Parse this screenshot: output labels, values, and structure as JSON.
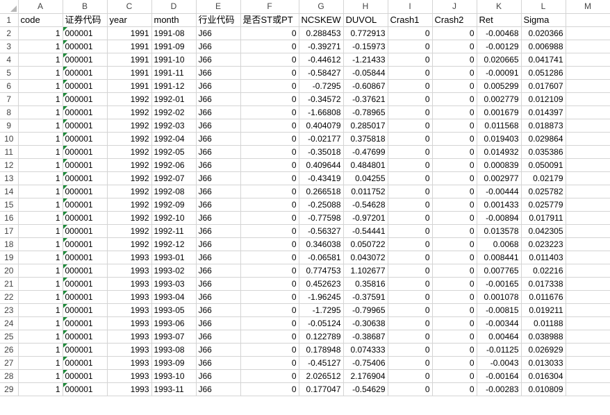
{
  "column_letters": [
    "A",
    "B",
    "C",
    "D",
    "E",
    "F",
    "G",
    "H",
    "I",
    "J",
    "K",
    "L",
    "M"
  ],
  "header_row": {
    "row_number": "1",
    "cells": [
      "code",
      "证券代码",
      "year",
      "month",
      "行业代码",
      "是否ST或PT",
      "NCSKEW",
      "DUVOL",
      "Crash1",
      "Crash2",
      "Ret",
      "Sigma",
      ""
    ]
  },
  "rows": [
    {
      "n": "2",
      "code": "1",
      "stock": "000001",
      "year": "1991",
      "month": "1991-08",
      "ind": "J66",
      "st": "0",
      "ncskew": "0.288453",
      "duvol": "0.772913",
      "c1": "0",
      "c2": "0",
      "ret": "-0.00468",
      "sigma": "0.020366"
    },
    {
      "n": "3",
      "code": "1",
      "stock": "000001",
      "year": "1991",
      "month": "1991-09",
      "ind": "J66",
      "st": "0",
      "ncskew": "-0.39271",
      "duvol": "-0.15973",
      "c1": "0",
      "c2": "0",
      "ret": "-0.00129",
      "sigma": "0.006988"
    },
    {
      "n": "4",
      "code": "1",
      "stock": "000001",
      "year": "1991",
      "month": "1991-10",
      "ind": "J66",
      "st": "0",
      "ncskew": "-0.44612",
      "duvol": "-1.21433",
      "c1": "0",
      "c2": "0",
      "ret": "0.020665",
      "sigma": "0.041741"
    },
    {
      "n": "5",
      "code": "1",
      "stock": "000001",
      "year": "1991",
      "month": "1991-11",
      "ind": "J66",
      "st": "0",
      "ncskew": "-0.58427",
      "duvol": "-0.05844",
      "c1": "0",
      "c2": "0",
      "ret": "-0.00091",
      "sigma": "0.051286"
    },
    {
      "n": "6",
      "code": "1",
      "stock": "000001",
      "year": "1991",
      "month": "1991-12",
      "ind": "J66",
      "st": "0",
      "ncskew": "-0.7295",
      "duvol": "-0.60867",
      "c1": "0",
      "c2": "0",
      "ret": "0.005299",
      "sigma": "0.017607"
    },
    {
      "n": "7",
      "code": "1",
      "stock": "000001",
      "year": "1992",
      "month": "1992-01",
      "ind": "J66",
      "st": "0",
      "ncskew": "-0.34572",
      "duvol": "-0.37621",
      "c1": "0",
      "c2": "0",
      "ret": "0.002779",
      "sigma": "0.012109"
    },
    {
      "n": "8",
      "code": "1",
      "stock": "000001",
      "year": "1992",
      "month": "1992-02",
      "ind": "J66",
      "st": "0",
      "ncskew": "-1.66808",
      "duvol": "-0.78965",
      "c1": "0",
      "c2": "0",
      "ret": "0.001679",
      "sigma": "0.014397"
    },
    {
      "n": "9",
      "code": "1",
      "stock": "000001",
      "year": "1992",
      "month": "1992-03",
      "ind": "J66",
      "st": "0",
      "ncskew": "0.404079",
      "duvol": "0.285017",
      "c1": "0",
      "c2": "0",
      "ret": "0.011568",
      "sigma": "0.018873"
    },
    {
      "n": "10",
      "code": "1",
      "stock": "000001",
      "year": "1992",
      "month": "1992-04",
      "ind": "J66",
      "st": "0",
      "ncskew": "-0.02177",
      "duvol": "0.375818",
      "c1": "0",
      "c2": "0",
      "ret": "0.019403",
      "sigma": "0.029864"
    },
    {
      "n": "11",
      "code": "1",
      "stock": "000001",
      "year": "1992",
      "month": "1992-05",
      "ind": "J66",
      "st": "0",
      "ncskew": "-0.35018",
      "duvol": "-0.47699",
      "c1": "0",
      "c2": "0",
      "ret": "0.014932",
      "sigma": "0.035386"
    },
    {
      "n": "12",
      "code": "1",
      "stock": "000001",
      "year": "1992",
      "month": "1992-06",
      "ind": "J66",
      "st": "0",
      "ncskew": "0.409644",
      "duvol": "0.484801",
      "c1": "0",
      "c2": "0",
      "ret": "0.000839",
      "sigma": "0.050091"
    },
    {
      "n": "13",
      "code": "1",
      "stock": "000001",
      "year": "1992",
      "month": "1992-07",
      "ind": "J66",
      "st": "0",
      "ncskew": "-0.43419",
      "duvol": "0.04255",
      "c1": "0",
      "c2": "0",
      "ret": "0.002977",
      "sigma": "0.02179"
    },
    {
      "n": "14",
      "code": "1",
      "stock": "000001",
      "year": "1992",
      "month": "1992-08",
      "ind": "J66",
      "st": "0",
      "ncskew": "0.266518",
      "duvol": "0.011752",
      "c1": "0",
      "c2": "0",
      "ret": "-0.00444",
      "sigma": "0.025782"
    },
    {
      "n": "15",
      "code": "1",
      "stock": "000001",
      "year": "1992",
      "month": "1992-09",
      "ind": "J66",
      "st": "0",
      "ncskew": "-0.25088",
      "duvol": "-0.54628",
      "c1": "0",
      "c2": "0",
      "ret": "0.001433",
      "sigma": "0.025779"
    },
    {
      "n": "16",
      "code": "1",
      "stock": "000001",
      "year": "1992",
      "month": "1992-10",
      "ind": "J66",
      "st": "0",
      "ncskew": "-0.77598",
      "duvol": "-0.97201",
      "c1": "0",
      "c2": "0",
      "ret": "-0.00894",
      "sigma": "0.017911"
    },
    {
      "n": "17",
      "code": "1",
      "stock": "000001",
      "year": "1992",
      "month": "1992-11",
      "ind": "J66",
      "st": "0",
      "ncskew": "-0.56327",
      "duvol": "-0.54441",
      "c1": "0",
      "c2": "0",
      "ret": "0.013578",
      "sigma": "0.042305"
    },
    {
      "n": "18",
      "code": "1",
      "stock": "000001",
      "year": "1992",
      "month": "1992-12",
      "ind": "J66",
      "st": "0",
      "ncskew": "0.346038",
      "duvol": "0.050722",
      "c1": "0",
      "c2": "0",
      "ret": "0.0068",
      "sigma": "0.023223"
    },
    {
      "n": "19",
      "code": "1",
      "stock": "000001",
      "year": "1993",
      "month": "1993-01",
      "ind": "J66",
      "st": "0",
      "ncskew": "-0.06581",
      "duvol": "0.043072",
      "c1": "0",
      "c2": "0",
      "ret": "0.008441",
      "sigma": "0.011403"
    },
    {
      "n": "20",
      "code": "1",
      "stock": "000001",
      "year": "1993",
      "month": "1993-02",
      "ind": "J66",
      "st": "0",
      "ncskew": "0.774753",
      "duvol": "1.102677",
      "c1": "0",
      "c2": "0",
      "ret": "0.007765",
      "sigma": "0.02216"
    },
    {
      "n": "21",
      "code": "1",
      "stock": "000001",
      "year": "1993",
      "month": "1993-03",
      "ind": "J66",
      "st": "0",
      "ncskew": "0.452623",
      "duvol": "0.35816",
      "c1": "0",
      "c2": "0",
      "ret": "-0.00165",
      "sigma": "0.017338"
    },
    {
      "n": "22",
      "code": "1",
      "stock": "000001",
      "year": "1993",
      "month": "1993-04",
      "ind": "J66",
      "st": "0",
      "ncskew": "-1.96245",
      "duvol": "-0.37591",
      "c1": "0",
      "c2": "0",
      "ret": "0.001078",
      "sigma": "0.011676"
    },
    {
      "n": "23",
      "code": "1",
      "stock": "000001",
      "year": "1993",
      "month": "1993-05",
      "ind": "J66",
      "st": "0",
      "ncskew": "-1.7295",
      "duvol": "-0.79965",
      "c1": "0",
      "c2": "0",
      "ret": "-0.00815",
      "sigma": "0.019211"
    },
    {
      "n": "24",
      "code": "1",
      "stock": "000001",
      "year": "1993",
      "month": "1993-06",
      "ind": "J66",
      "st": "0",
      "ncskew": "-0.05124",
      "duvol": "-0.30638",
      "c1": "0",
      "c2": "0",
      "ret": "-0.00344",
      "sigma": "0.01188"
    },
    {
      "n": "25",
      "code": "1",
      "stock": "000001",
      "year": "1993",
      "month": "1993-07",
      "ind": "J66",
      "st": "0",
      "ncskew": "0.122789",
      "duvol": "-0.38687",
      "c1": "0",
      "c2": "0",
      "ret": "0.00464",
      "sigma": "0.038988"
    },
    {
      "n": "26",
      "code": "1",
      "stock": "000001",
      "year": "1993",
      "month": "1993-08",
      "ind": "J66",
      "st": "0",
      "ncskew": "0.178948",
      "duvol": "0.074333",
      "c1": "0",
      "c2": "0",
      "ret": "-0.01125",
      "sigma": "0.026929"
    },
    {
      "n": "27",
      "code": "1",
      "stock": "000001",
      "year": "1993",
      "month": "1993-09",
      "ind": "J66",
      "st": "0",
      "ncskew": "-0.45127",
      "duvol": "-0.75406",
      "c1": "0",
      "c2": "0",
      "ret": "-0.0043",
      "sigma": "0.013033"
    },
    {
      "n": "28",
      "code": "1",
      "stock": "000001",
      "year": "1993",
      "month": "1993-10",
      "ind": "J66",
      "st": "0",
      "ncskew": "2.026512",
      "duvol": "2.176904",
      "c1": "0",
      "c2": "0",
      "ret": "-0.00164",
      "sigma": "0.016304"
    },
    {
      "n": "29",
      "code": "1",
      "stock": "000001",
      "year": "1993",
      "month": "1993-11",
      "ind": "J66",
      "st": "0",
      "ncskew": "0.177047",
      "duvol": "-0.54629",
      "c1": "0",
      "c2": "0",
      "ret": "-0.00283",
      "sigma": "0.010809"
    }
  ],
  "colors": {
    "gridline": "#d4d4d4",
    "header_text": "#444444",
    "text_indicator": "#1e8a3a"
  }
}
